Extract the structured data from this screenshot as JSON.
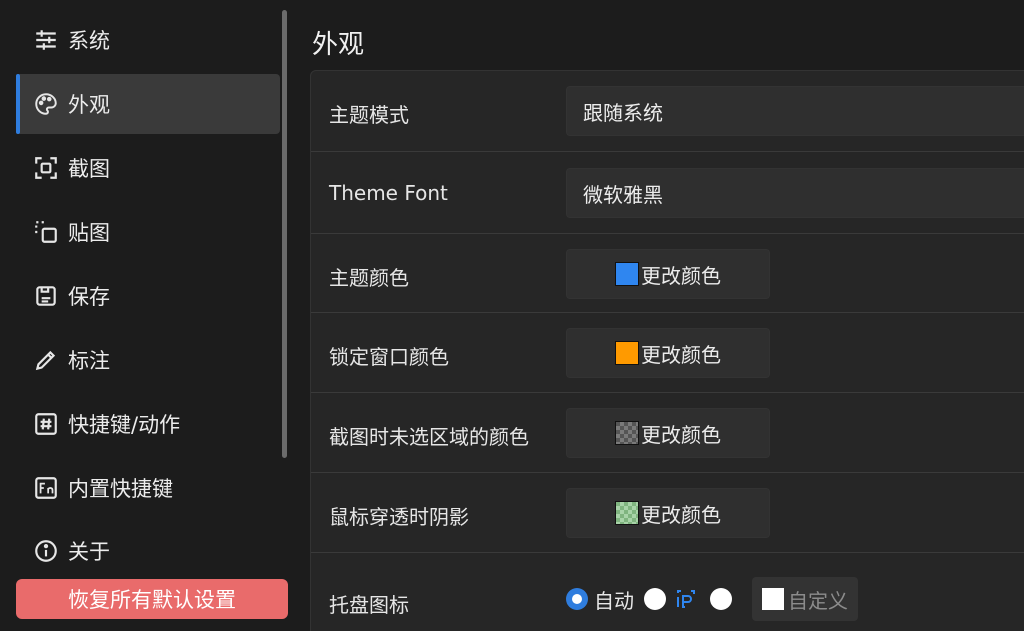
{
  "sidebar": {
    "items": [
      {
        "label": "系统",
        "icon": "sliders-icon"
      },
      {
        "label": "外观",
        "icon": "palette-icon"
      },
      {
        "label": "截图",
        "icon": "screenshot-icon"
      },
      {
        "label": "贴图",
        "icon": "pin-image-icon"
      },
      {
        "label": "保存",
        "icon": "save-icon"
      },
      {
        "label": "标注",
        "icon": "pencil-icon"
      },
      {
        "label": "快捷键/动作",
        "icon": "hash-icon"
      },
      {
        "label": "内置快捷键",
        "icon": "fn-key-icon"
      },
      {
        "label": "关于",
        "icon": "info-icon"
      }
    ],
    "active_index": 1,
    "reset_label": "恢复所有默认设置"
  },
  "main": {
    "title": "外观",
    "rows": {
      "theme_mode": {
        "label": "主题模式",
        "value": "跟随系统"
      },
      "theme_font": {
        "label": "Theme Font",
        "value": "微软雅黑"
      },
      "theme_color": {
        "label": "主题颜色",
        "button": "更改颜色",
        "swatch": "#2f86f0"
      },
      "lock_color": {
        "label": "锁定窗口颜色",
        "button": "更改颜色",
        "swatch": "#ff9a00"
      },
      "unselected_color": {
        "label": "截图时未选区域的颜色",
        "button": "更改颜色"
      },
      "mouse_shadow": {
        "label": "鼠标穿透时阴影",
        "button": "更改颜色"
      },
      "tray_icon": {
        "label": "托盘图标",
        "auto_label": "自动",
        "custom_label": "自定义"
      }
    }
  },
  "colors": {
    "accent": "#2f7dde",
    "reset_button": "#e96b6b"
  }
}
